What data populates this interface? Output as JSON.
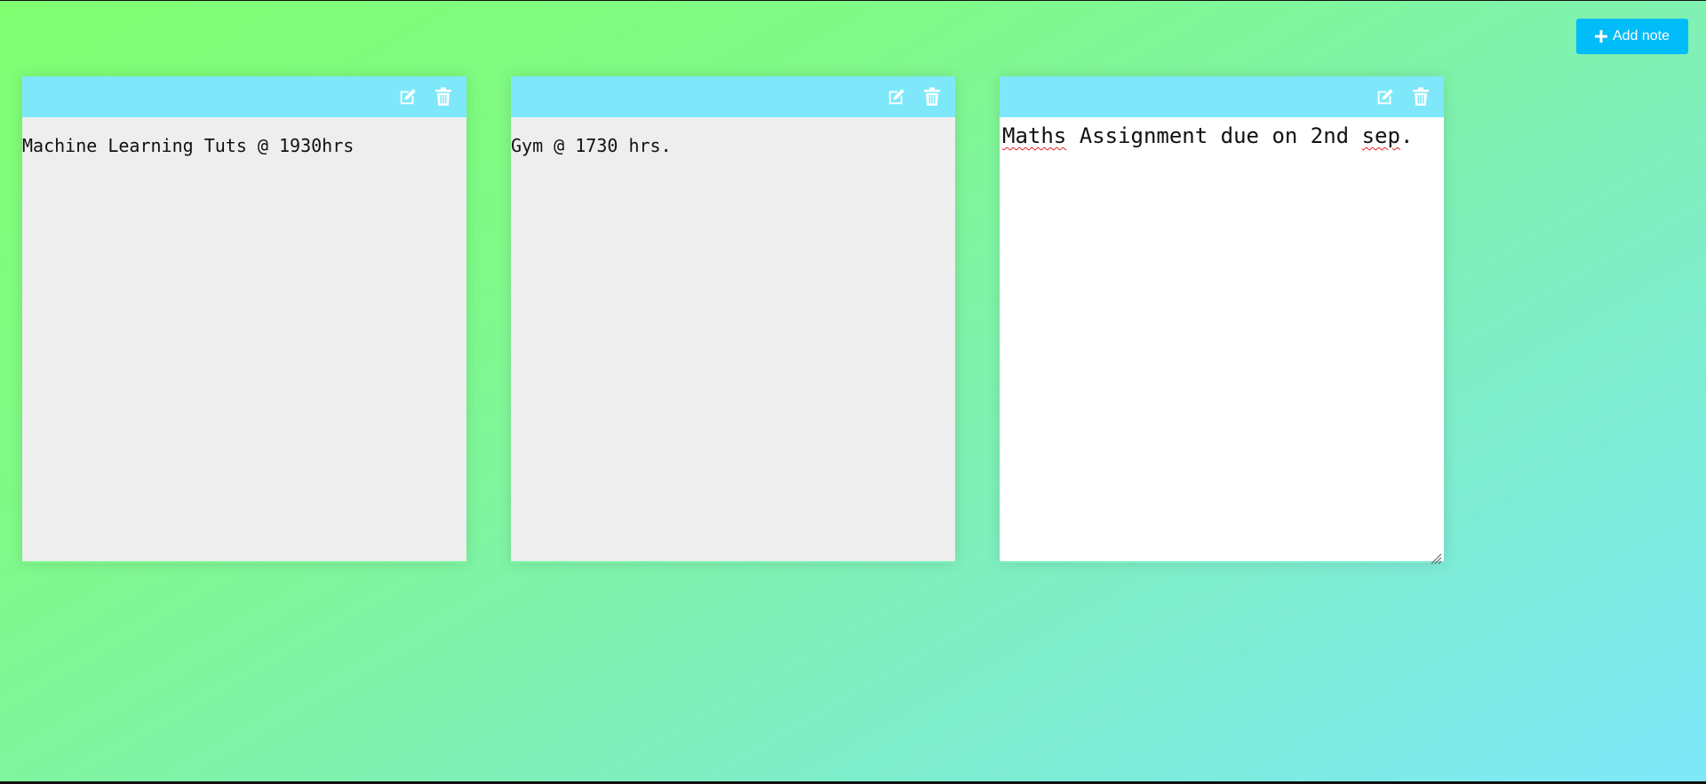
{
  "toolbar": {
    "add_label": "Add note",
    "add_icon": "plus-icon"
  },
  "colors": {
    "note_header": "#7ee8fa",
    "add_button": "#00bcf8",
    "note_body": "#eeeeee",
    "background_start": "#80ff72",
    "background_end": "#7ee8fa"
  },
  "notes": [
    {
      "text": "Machine Learning Tuts @ 1930hrs",
      "editing": false,
      "icons": [
        "edit-icon",
        "trash-icon"
      ]
    },
    {
      "text": "Gym @ 1730 hrs.",
      "editing": false,
      "icons": [
        "edit-icon",
        "trash-icon"
      ]
    },
    {
      "text": "Maths Assignment due on 2nd sep.",
      "editing": true,
      "icons": [
        "edit-icon",
        "trash-icon"
      ],
      "segments": {
        "w1": "Maths",
        "w2": " Assignment due on 2nd ",
        "w3": "sep",
        "w4": "."
      }
    }
  ]
}
